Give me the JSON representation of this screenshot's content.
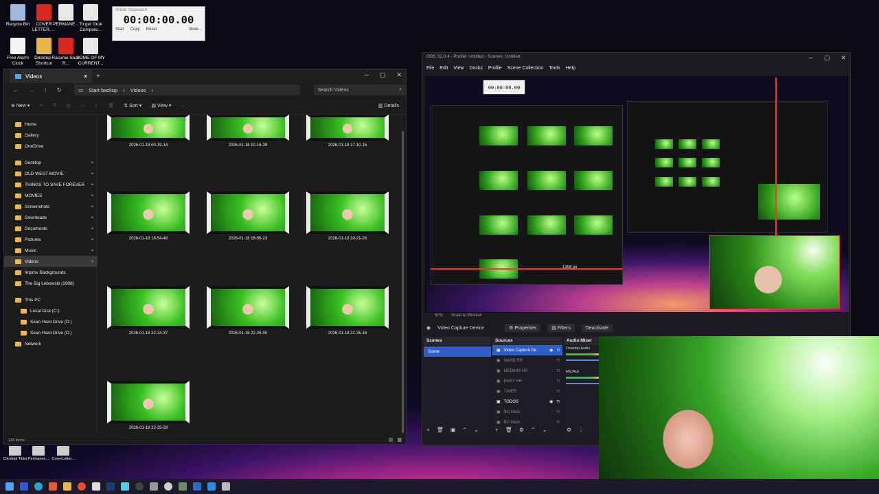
{
  "desktop_icons": [
    {
      "label": "Recycle Bin",
      "color": "#9bb7d9"
    },
    {
      "label": "COVER LETTER, ...",
      "color": "#d9281e"
    },
    {
      "label": "PERMANE...",
      "color": "#e8e8e8"
    },
    {
      "label": "To get Grok Compute...",
      "color": "#e8e8e8"
    },
    {
      "label": "Free Alarm Clock",
      "color": "#f4f4f4"
    },
    {
      "label": "Desktop - Shortcut",
      "color": "#e8b84a"
    },
    {
      "label": "Rasume Sean R...",
      "color": "#d9281e"
    },
    {
      "label": "SOME OF MY CURRENT...",
      "color": "#e8e8e8"
    }
  ],
  "stopwatch": {
    "title": "XNote Stopwatch",
    "time": "00:00:00.00",
    "start": "Start",
    "copy": "Copy",
    "reset": "Reset",
    "more": "More..."
  },
  "explorer": {
    "tab_title": "Videos",
    "breadcrumb": [
      "Start backup",
      "Videos"
    ],
    "search_placeholder": "Search Videos",
    "toolbar": {
      "new": "New",
      "sort": "Sort",
      "view": "View",
      "more": "...",
      "details": "Details"
    },
    "nav": [
      {
        "label": "Home",
        "pinned": false
      },
      {
        "label": "Gallery",
        "pinned": false
      },
      {
        "label": "OneDrive",
        "pinned": false
      },
      {
        "label": "Desktop",
        "pinned": true
      },
      {
        "label": "OLD WEST MOVIE",
        "pinned": true
      },
      {
        "label": "THINGS TO SAVE FOREVER",
        "pinned": true
      },
      {
        "label": "MOVIES",
        "pinned": true
      },
      {
        "label": "Screenshots",
        "pinned": true
      },
      {
        "label": "Downloads",
        "pinned": true
      },
      {
        "label": "Documents",
        "pinned": true
      },
      {
        "label": "Pictures",
        "pinned": true
      },
      {
        "label": "Music",
        "pinned": true
      },
      {
        "label": "Videos",
        "pinned": true,
        "selected": true
      },
      {
        "label": "Improv Backgrounds",
        "pinned": false
      },
      {
        "label": "The Big Lebowski (1998)",
        "pinned": false
      },
      {
        "label": "This PC",
        "pinned": false
      },
      {
        "label": "Local Disk (C:)",
        "pinned": false
      },
      {
        "label": "Sean Hard Drive (D:)",
        "pinned": false
      },
      {
        "label": "Sean Hard Drive (D:)",
        "pinned": false
      },
      {
        "label": "Network",
        "pinned": false
      }
    ],
    "videos": [
      "2026-01-18 00-19-14",
      "2026-01-18 10-15-39",
      "2026-01-18 17-10-15",
      "2026-01-18 18-54-48",
      "2026-01-18 18-56-23",
      "2026-01-18 20-21-26",
      "2026-01-18 22-24-37",
      "2026-01-18 22-25-00",
      "2026-01-18 22-25-16",
      "2026-01-18 22-25-29"
    ],
    "status": "139 items"
  },
  "obs": {
    "title": "OBS 32.0.4 - Profile: Untitled - Scenes: Untitled",
    "menu": [
      "File",
      "Edit",
      "View",
      "Docks",
      "Profile",
      "Scene Collection",
      "Tools",
      "Help"
    ],
    "preview_label": "1308 px",
    "scale_text": "Scale to Window",
    "zoom": "62%",
    "source_name": "Video Capture Device",
    "properties": "Properties",
    "filters": "Filters",
    "deactivate": "Deactivate",
    "scenes_header": "Scenes",
    "scenes": [
      "Scene"
    ],
    "sources_header": "Sources",
    "sources": [
      {
        "name": "Video Capture De",
        "on": true,
        "selected": true
      },
      {
        "name": "HARD HR",
        "on": false
      },
      {
        "name": "MEDIUM HR",
        "on": false
      },
      {
        "name": "EASY HR",
        "on": false
      },
      {
        "name": "TIMER",
        "on": false
      },
      {
        "name": "TODOS",
        "on": true
      },
      {
        "name": "BG Main",
        "on": false
      },
      {
        "name": "BG Main",
        "on": false
      }
    ],
    "mixer_header": "Audio Mixer",
    "mixer": [
      {
        "name": "Desktop Audio"
      },
      {
        "name": "Mic/Aux"
      }
    ]
  },
  "bottom_icons": [
    "Clickbait Titles",
    "Permanen...",
    "CoverLetter..."
  ]
}
